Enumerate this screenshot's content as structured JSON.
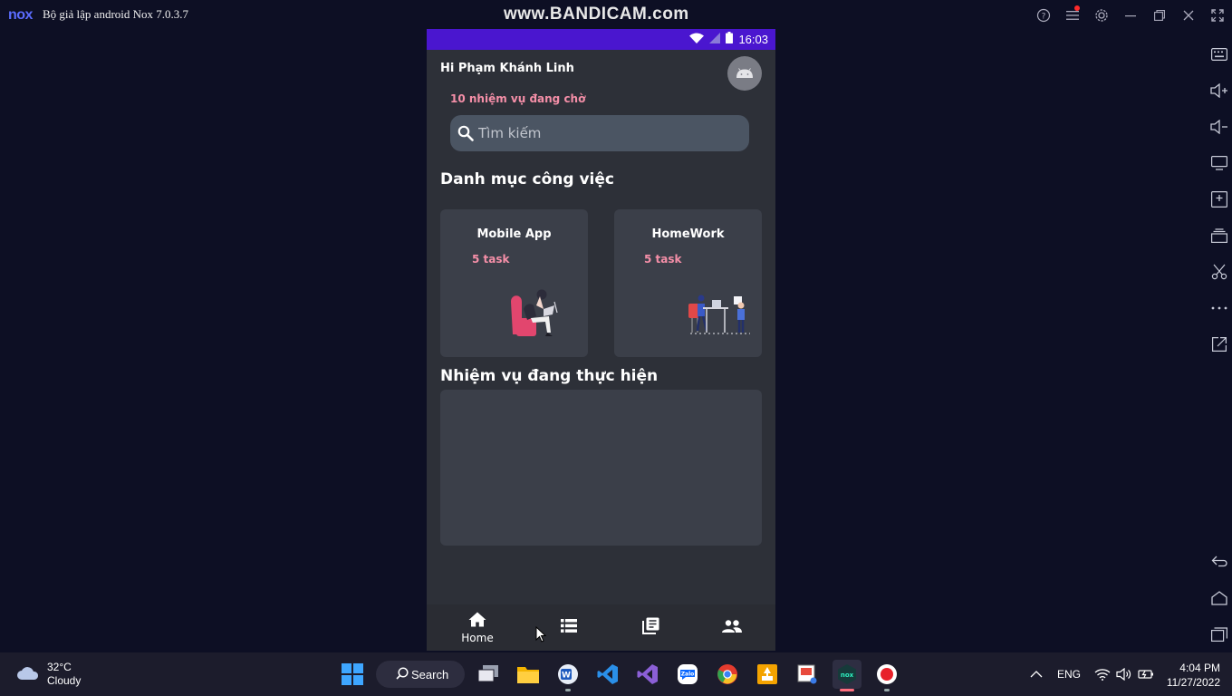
{
  "window": {
    "logo": "nox",
    "title": "Bộ giả lập android Nox 7.0.3.7",
    "watermark": "www.BANDICAM.com",
    "controls": [
      "help-icon",
      "menu-icon",
      "settings-icon",
      "minimize-icon",
      "restore-icon",
      "close-icon",
      "fullscreen-icon"
    ]
  },
  "sidebar": {
    "icons": [
      "keyboard-icon",
      "volume-up-icon",
      "volume-down-icon",
      "screen-icon",
      "apk-install-icon",
      "multi-instance-icon",
      "scissors-icon",
      "more-icon",
      "export-icon",
      "back-icon",
      "home-icon",
      "recent-apps-icon"
    ]
  },
  "phone": {
    "status": {
      "time": "16:03"
    },
    "greeting": "Hi Phạm Khánh Linh",
    "pending": "10 nhiệm vụ đang chờ",
    "search": {
      "placeholder": "Tìm kiếm"
    },
    "categories_title": "Danh mục công việc",
    "categories": [
      {
        "title": "Mobile App",
        "count": "5 task"
      },
      {
        "title": "HomeWork",
        "count": "5 task"
      }
    ],
    "in_progress_title": "Nhiệm vụ đang thực hiện",
    "nav": [
      {
        "icon": "home-icon",
        "label": "Home"
      },
      {
        "icon": "list-icon",
        "label": ""
      },
      {
        "icon": "library-icon",
        "label": ""
      },
      {
        "icon": "people-icon",
        "label": ""
      }
    ]
  },
  "taskbar": {
    "weather": {
      "temp": "32°C",
      "condition": "Cloudy"
    },
    "search_label": "Search",
    "tray": {
      "language": "ENG"
    },
    "clock": {
      "time": "4:04 PM",
      "date": "11/27/2022"
    },
    "colors": {
      "accent": "#4a16cf",
      "pink": "#f58fa8"
    }
  }
}
